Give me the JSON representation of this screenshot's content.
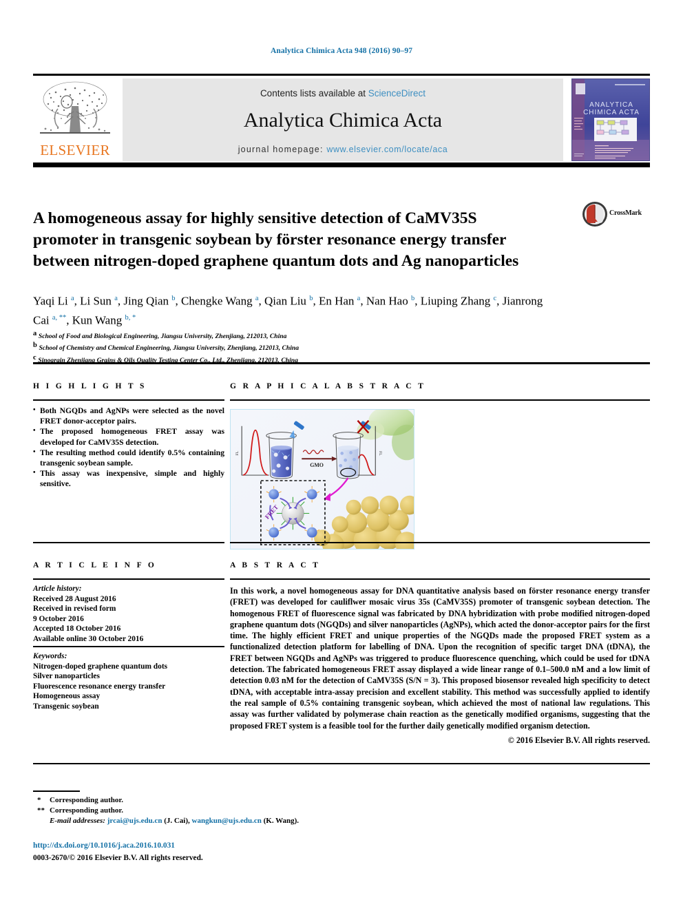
{
  "running_head": "Analytica Chimica Acta 948 (2016) 90–97",
  "masthead": {
    "publisher": "ELSEVIER",
    "publisher_logo_icon": "elsevier-tree-logo",
    "contents_prefix": "Contents lists available at ",
    "contents_link": "ScienceDirect",
    "journal_title": "Analytica Chimica Acta",
    "homepage_prefix": "journal homepage: ",
    "homepage_link": "www.elsevier.com/locate/aca",
    "cover_thumb_icon": "journal-cover-thumbnail",
    "cover_title": "ANALYTICA CHIMICA ACTA"
  },
  "article": {
    "title": "A homogeneous assay for highly sensitive detection of CaMV35S promoter in transgenic soybean by förster resonance energy transfer between nitrogen-doped graphene quantum dots and Ag nanoparticles",
    "crossmark_label": "CrossMark",
    "crossmark_icon": "crossmark-logo",
    "authors": [
      {
        "name": "Yaqi Li",
        "sup": "a",
        "sep": ", "
      },
      {
        "name": "Li Sun",
        "sup": "a",
        "sep": ", "
      },
      {
        "name": "Jing Qian",
        "sup": "b",
        "sep": ", "
      },
      {
        "name": "Chengke Wang",
        "sup": "a",
        "sep": ", "
      },
      {
        "name": "Qian Liu",
        "sup": "b",
        "sep": ", "
      },
      {
        "name": "En Han",
        "sup": "a",
        "sep": ", "
      },
      {
        "name": "Nan Hao",
        "sup": "b",
        "sep": ", "
      },
      {
        "name": "Liuping Zhang",
        "sup": "c",
        "sep": ", "
      },
      {
        "name": "Jianrong Cai",
        "sup": "a, **",
        "sep": ", "
      },
      {
        "name": "Kun Wang",
        "sup": "b, *",
        "sep": ""
      }
    ],
    "affiliations": [
      {
        "sup": "a",
        "text": "School of Food and Biological Engineering, Jiangsu University, Zhenjiang, 212013, China"
      },
      {
        "sup": "b",
        "text": "School of Chemistry and Chemical Engineering, Jiangsu University, Zhenjiang, 212013, China"
      },
      {
        "sup": "c",
        "text": "Sinograin Zhenjiang Grains & Oils Quality Testing Center Co., Ltd., Zhenjiang, 212013, China"
      }
    ]
  },
  "highlights": {
    "heading": "H I G H L I G H T S",
    "items": [
      "Both NGQDs and AgNPs were selected as the novel FRET donor-acceptor pairs.",
      "The proposed homogeneous FRET assay was developed for CaMV35S detection.",
      "The resulting method could identify 0.5% containing transgenic soybean sample.",
      "This assay was inexpensive, simple and highly sensitive."
    ]
  },
  "graphical_abstract": {
    "heading": "G R A P H I C A L  A B S T R A C T",
    "figure_icon": "graphical-abstract-figure",
    "labels": {
      "arrow_label": "GMO",
      "fret_label": "FRET",
      "y_axis_left": "FL",
      "y_axis_right": "FL"
    }
  },
  "article_info": {
    "heading": "A R T I C L E  I N F O",
    "history_label": "Article history:",
    "history": [
      "Received 28 August 2016",
      "Received in revised form",
      "9 October 2016",
      "Accepted 18 October 2016",
      "Available online 30 October 2016"
    ],
    "keywords_label": "Keywords:",
    "keywords": [
      "Nitrogen-doped graphene quantum dots",
      "Silver nanoparticles",
      "Fluorescence resonance energy transfer",
      "Homogeneous assay",
      "Transgenic soybean"
    ]
  },
  "abstract": {
    "heading": "A B S T R A C T",
    "body": "In this work, a novel homogeneous assay for DNA quantitative analysis based on förster resonance energy transfer (FRET) was developed for cauliflwer mosaic virus 35s (CaMV35S) promoter of transgenic soybean detection. The homogenous FRET of fluorescence signal was fabricated by DNA hybridization with probe modified nitrogen-doped graphene quantum dots (NGQDs) and silver nanoparticles (AgNPs), which acted the donor-acceptor pairs for the first time. The highly efficient FRET and unique properties of the NGQDs made the proposed FRET system as a functionalized detection platform for labelling of DNA. Upon the recognition of specific target DNA (tDNA), the FRET between NGQDs and AgNPs was triggered to produce fluorescence quenching, which could be used for tDNA detection. The fabricated homogeneous FRET assay displayed a wide linear range of 0.1–500.0 nM and a low limit of detection 0.03 nM for the detection of CaMV35S (S/N = 3). This proposed biosensor revealed high specificity to detect tDNA, with acceptable intra-assay precision and excellent stability. This method was successfully applied to identify the real sample of 0.5% containing transgenic soybean, which achieved the most of national law regulations. This assay was further validated by polymerase chain reaction as the genetically modified organisms, suggesting that the proposed FRET system is a feasible tool for the further daily genetically modified organism detection.",
    "copyright": "© 2016 Elsevier B.V. All rights reserved."
  },
  "footer": {
    "corresponding_1_mark": "*",
    "corresponding_1": "Corresponding author.",
    "corresponding_2_mark": "**",
    "corresponding_2": "Corresponding author.",
    "email_label": "E-mail addresses: ",
    "email_1": "jrcai@ujs.edu.cn",
    "email_1_name": " (J. Cai), ",
    "email_2": "wangkun@ujs.edu.cn",
    "email_2_name": " (K. Wang).",
    "doi": "http://dx.doi.org/10.1016/j.aca.2016.10.031",
    "issn": "0003-2670/© 2016 Elsevier B.V. All rights reserved."
  },
  "colors": {
    "link_blue": "#1571a6",
    "sciencedirect_blue": "#3e8fc1",
    "elsevier_orange": "#e87722",
    "masthead_gray": "#e6e6e6"
  }
}
